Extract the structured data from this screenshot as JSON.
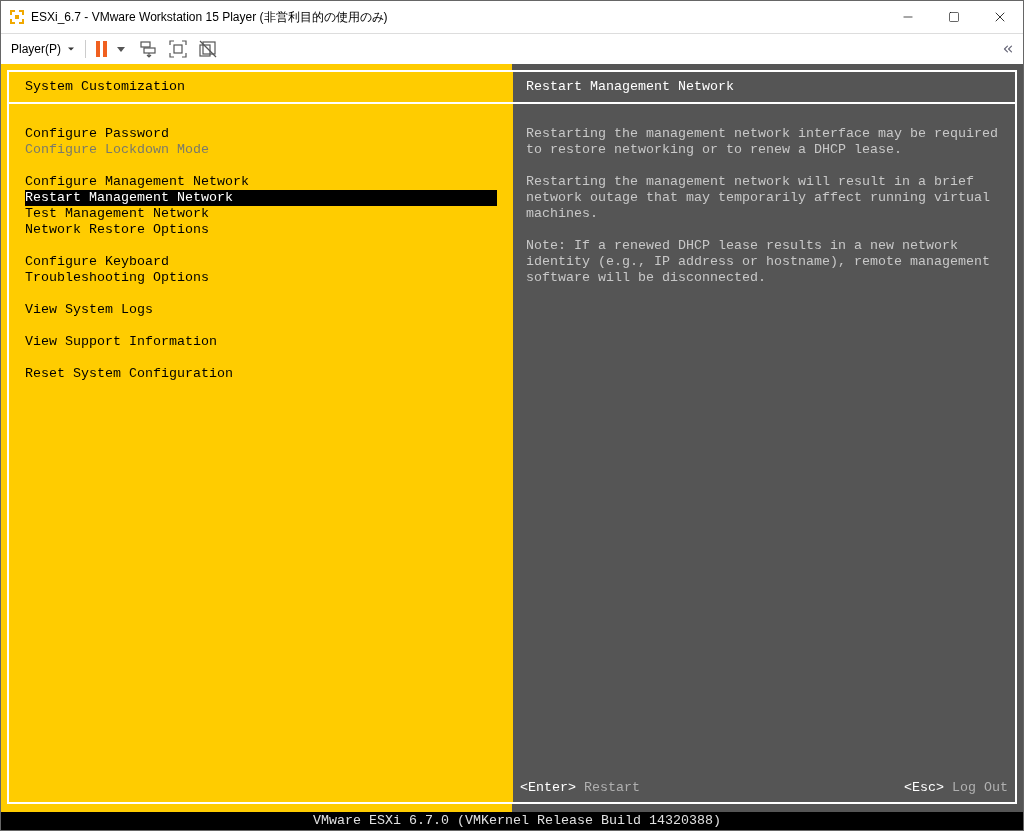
{
  "window": {
    "title": "ESXi_6.7 - VMware Workstation 15 Player (非営利目的の使用のみ)"
  },
  "toolbar": {
    "player_menu": "Player(P)"
  },
  "menu_panel": {
    "title": "System Customization",
    "groups": [
      {
        "items": [
          {
            "label": "Configure Password",
            "selected": false,
            "disabled": false
          },
          {
            "label": "Configure Lockdown Mode",
            "selected": false,
            "disabled": true
          }
        ]
      },
      {
        "items": [
          {
            "label": "Configure Management Network",
            "selected": false,
            "disabled": false
          },
          {
            "label": "Restart Management Network",
            "selected": true,
            "disabled": false
          },
          {
            "label": "Test Management Network",
            "selected": false,
            "disabled": false
          },
          {
            "label": "Network Restore Options",
            "selected": false,
            "disabled": false
          }
        ]
      },
      {
        "items": [
          {
            "label": "Configure Keyboard",
            "selected": false,
            "disabled": false
          },
          {
            "label": "Troubleshooting Options",
            "selected": false,
            "disabled": false
          }
        ]
      },
      {
        "items": [
          {
            "label": "View System Logs",
            "selected": false,
            "disabled": false
          }
        ]
      },
      {
        "items": [
          {
            "label": "View Support Information",
            "selected": false,
            "disabled": false
          }
        ]
      },
      {
        "items": [
          {
            "label": "Reset System Configuration",
            "selected": false,
            "disabled": false
          }
        ]
      }
    ]
  },
  "detail_panel": {
    "title": "Restart Management Network",
    "paragraphs": [
      [
        "Restarting the management network interface may be required",
        "to restore networking or to renew a DHCP lease."
      ],
      [
        "Restarting the management network will result in a brief",
        "network outage that may temporarily affect running virtual",
        "machines."
      ],
      [
        "Note: If a renewed DHCP lease results in a new network",
        "identity (e.g., IP address or hostname), remote management",
        "software will be disconnected."
      ]
    ],
    "footer": [
      {
        "key": "<Enter>",
        "action": "Restart"
      },
      {
        "key": "<Esc>",
        "action": "Log Out"
      }
    ]
  },
  "status_bar": "VMware ESXi 6.7.0 (VMKernel Release Build 14320388)"
}
